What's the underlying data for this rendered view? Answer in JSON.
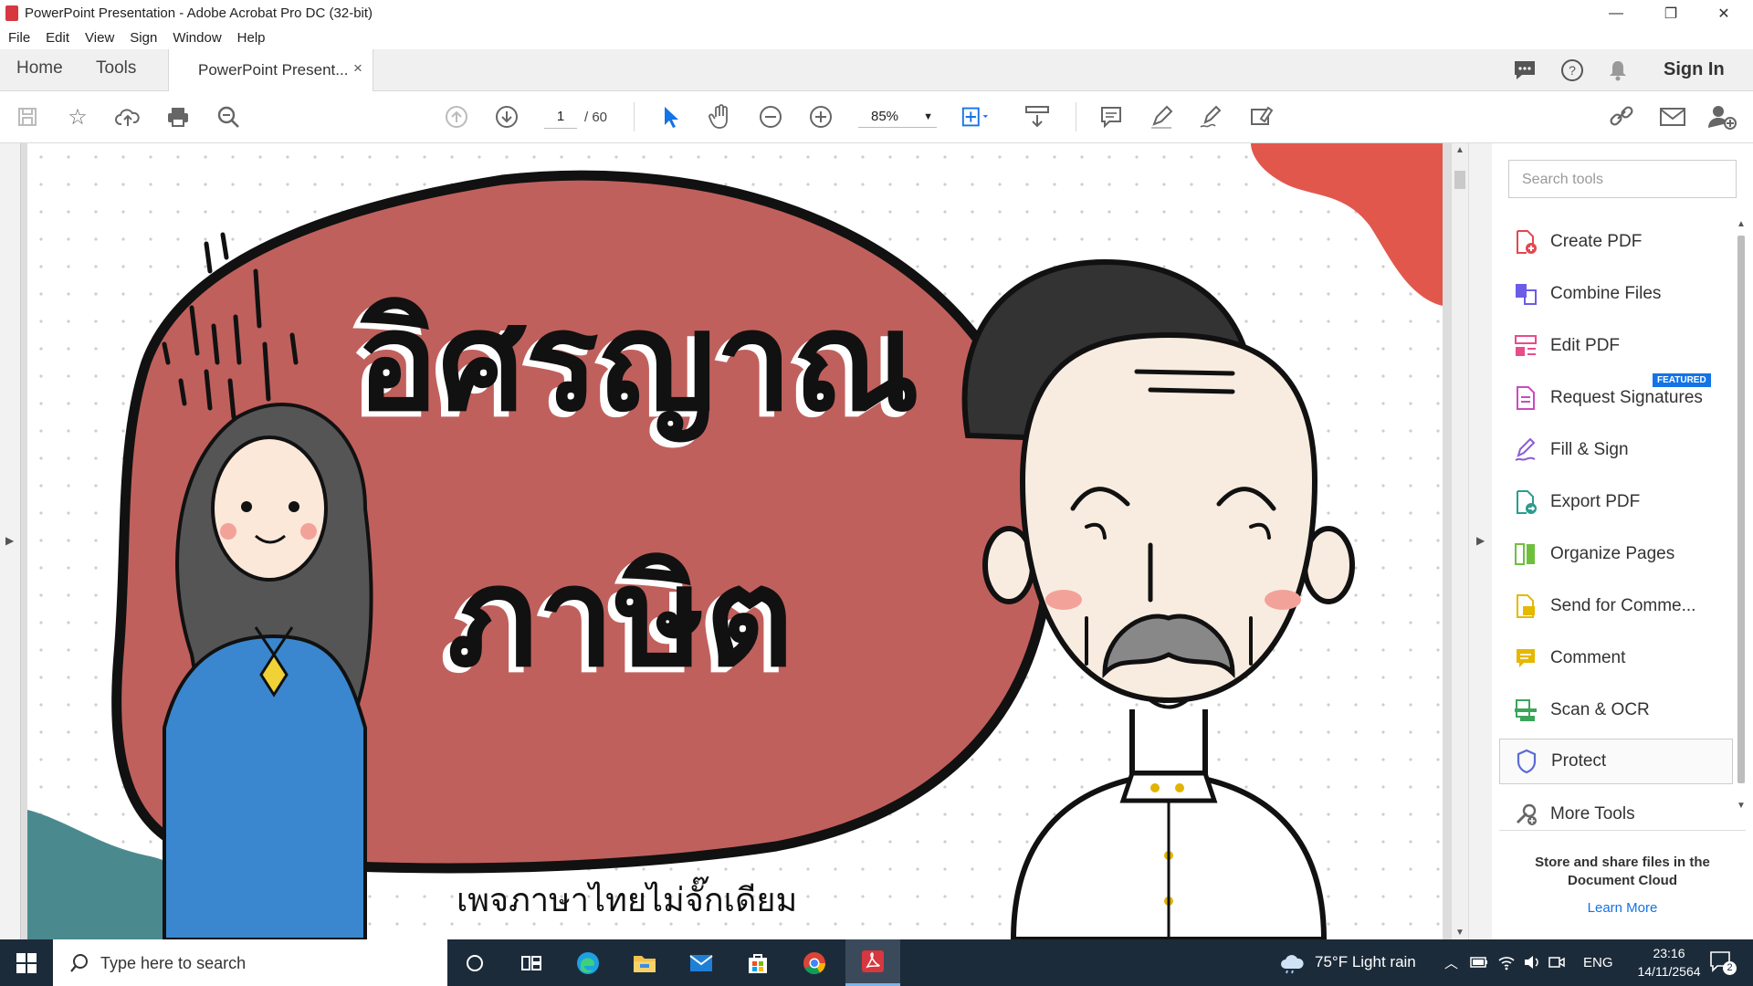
{
  "window": {
    "title": "PowerPoint Presentation - Adobe Acrobat Pro DC (32-bit)",
    "minimize": "—",
    "restore": "❐",
    "close": "✕"
  },
  "menu": [
    "File",
    "Edit",
    "View",
    "Sign",
    "Window",
    "Help"
  ],
  "tabs": {
    "home": "Home",
    "tools": "Tools",
    "document": "PowerPoint Present...",
    "close": "×",
    "sign_in": "Sign In"
  },
  "toolbar": {
    "page_current": "1",
    "page_total": "/ 60",
    "zoom": "85%"
  },
  "document": {
    "title_line1": "อิศรญาณ",
    "title_line2": "ภาษิต",
    "subtitle": "เพจภาษาไทยไม่จั๊กเดียม"
  },
  "tools_pane": {
    "search_placeholder": "Search tools",
    "featured_badge": "FEATURED",
    "items": [
      {
        "label": "Create PDF",
        "icon": "create-pdf-icon",
        "color": "#e34850"
      },
      {
        "label": "Combine Files",
        "icon": "combine-files-icon",
        "color": "#6b5ce7"
      },
      {
        "label": "Edit PDF",
        "icon": "edit-pdf-icon",
        "color": "#e84c8b"
      },
      {
        "label": "Request Signatures",
        "icon": "request-signatures-icon",
        "color": "#c94bbf"
      },
      {
        "label": "Fill & Sign",
        "icon": "fill-sign-icon",
        "color": "#8a5cd8"
      },
      {
        "label": "Export PDF",
        "icon": "export-pdf-icon",
        "color": "#2a9d8f"
      },
      {
        "label": "Organize Pages",
        "icon": "organize-pages-icon",
        "color": "#6fbf3f"
      },
      {
        "label": "Send for Comme...",
        "icon": "send-for-comment-icon",
        "color": "#e6b800"
      },
      {
        "label": "Comment",
        "icon": "comment-icon",
        "color": "#e6b800"
      },
      {
        "label": "Scan & OCR",
        "icon": "scan-ocr-icon",
        "color": "#3aa65a"
      },
      {
        "label": "Protect",
        "icon": "protect-icon",
        "color": "#5b6bd6"
      },
      {
        "label": "More Tools",
        "icon": "more-tools-icon",
        "color": "#666666"
      }
    ],
    "cloud_text": "Store and share files in the Document Cloud",
    "learn_more": "Learn More"
  },
  "taskbar": {
    "search_placeholder": "Type here to search",
    "weather": "75°F  Light rain",
    "language": "ENG",
    "time": "23:16",
    "date": "14/11/2564",
    "notifications": "2"
  }
}
